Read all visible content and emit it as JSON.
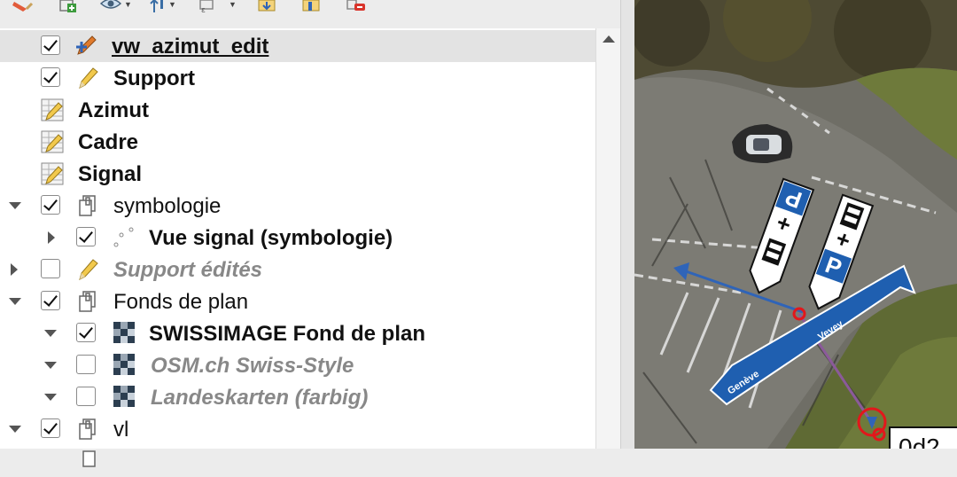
{
  "toolbar": {
    "icons": [
      "paint-brush-icon",
      "add-group-icon",
      "eye-icon",
      "filter-legend-icon",
      "filter-expression-icon",
      "expand-all-icon",
      "collapse-all-icon",
      "remove-layer-icon"
    ]
  },
  "layers": [
    {
      "label": "vw_azimut_edit",
      "checked": true,
      "icon": "edit-pencil-layer-icon"
    },
    {
      "label": "Support",
      "checked": true,
      "icon": "pencil-icon"
    },
    {
      "label": "Azimut",
      "icon": "table-edit-icon"
    },
    {
      "label": "Cadre",
      "icon": "table-edit-icon"
    },
    {
      "label": "Signal",
      "icon": "table-edit-icon"
    },
    {
      "label": "symbologie",
      "checked": true,
      "icon": "group-icon"
    },
    {
      "label": "Vue signal (symbologie)",
      "checked": true,
      "icon": "point-layer-icon"
    },
    {
      "label": "Support édités",
      "checked": false,
      "icon": "pencil-icon"
    },
    {
      "label": "Fonds de plan",
      "checked": true,
      "icon": "group-icon"
    },
    {
      "label": "SWISSIMAGE Fond de plan",
      "checked": true,
      "icon": "raster-layer-icon"
    },
    {
      "label": "OSM.ch Swiss-Style",
      "checked": false,
      "icon": "raster-layer-icon"
    },
    {
      "label": "Landeskarten (farbig)",
      "checked": false,
      "icon": "raster-layer-icon"
    },
    {
      "label": "vl",
      "checked": true,
      "icon": "group-icon"
    }
  ],
  "map": {
    "sign_left_text": "Genève",
    "sign_right_text": "Vevey",
    "parking_letter": "P",
    "parking_plus": "+",
    "label_fragment": "0d2"
  }
}
